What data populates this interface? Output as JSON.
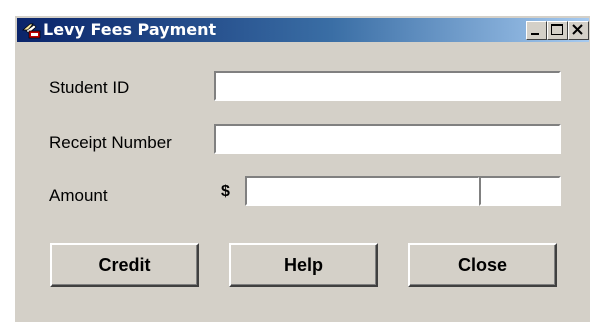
{
  "window": {
    "title": "Levy Fees Payment",
    "controls": [
      "minimize",
      "maximize",
      "close"
    ]
  },
  "form": {
    "student_id_label": "Student ID",
    "student_id_value": "",
    "receipt_number_label": "Receipt Number",
    "receipt_number_value": "",
    "amount_label": "Amount",
    "currency_symbol": "$",
    "amount_dollars_value": "",
    "amount_cents_value": ""
  },
  "buttons": {
    "credit_label": "Credit",
    "help_label": "Help",
    "close_label": "Close"
  },
  "colors": {
    "titlebar_start": "#0a246a",
    "titlebar_end": "#a6caf0",
    "face": "#d4d0c8"
  }
}
